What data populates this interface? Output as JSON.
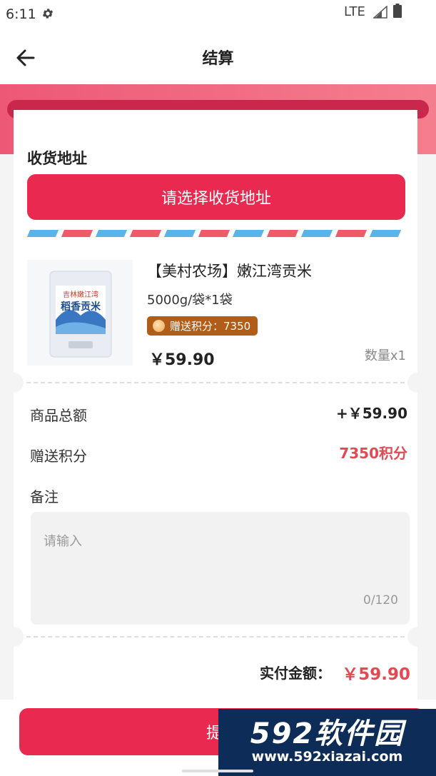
{
  "status_bar": {
    "time": "6:11",
    "network": "LTE",
    "icons": [
      "gear-icon",
      "signal-icon",
      "battery-icon"
    ]
  },
  "nav": {
    "title": "结算",
    "back_icon": "arrow-left-icon"
  },
  "address": {
    "section_title": "收货地址",
    "select_button": "请选择收货地址"
  },
  "product": {
    "image_text_line1": "吉林嫩江湾",
    "image_text_line2": "稻香贡米",
    "title": "【美村农场】嫩江湾贡米",
    "spec": "5000g/袋*1袋",
    "points_badge": "赠送积分：7350",
    "price": "￥59.90",
    "quantity": "数量x1"
  },
  "summary": {
    "goods_total_label": "商品总额",
    "goods_total_value": "+￥59.90",
    "points_label": "赠送积分",
    "points_value": "7350积分",
    "note_label": "备注",
    "note_placeholder": "请输入",
    "note_counter": "0/120"
  },
  "total": {
    "label": "实付金额：",
    "value": "￥59.90"
  },
  "submit": {
    "label": "提交"
  },
  "watermark": {
    "logo": "592软件园",
    "url": "www.592xiazai.com"
  },
  "colors": {
    "primary": "#e9294f",
    "price_red": "#e24a53",
    "badge_brown": "#b25d17",
    "stripe_red": "#ef5a68",
    "stripe_blue": "#5ab4ea"
  }
}
